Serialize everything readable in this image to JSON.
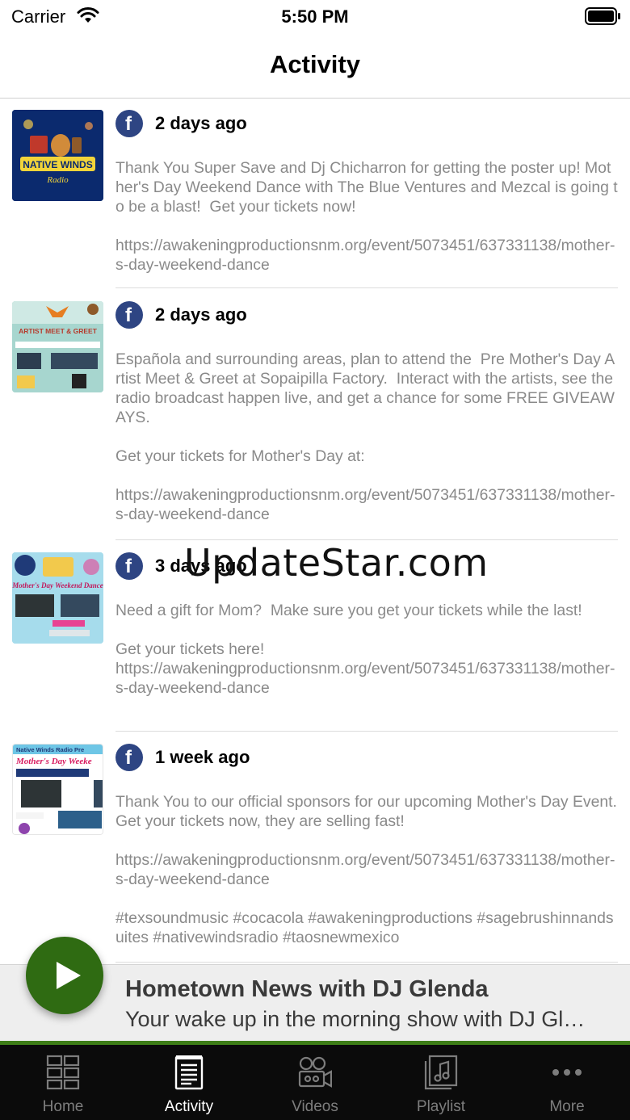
{
  "status_bar": {
    "carrier": "Carrier",
    "time": "5:50 PM"
  },
  "nav": {
    "title": "Activity"
  },
  "posts": [
    {
      "source_icon": "facebook-icon",
      "time": "2 days ago",
      "text": "Thank You Super Save and Dj Chicharron for getting the poster up! Mother's Day Weekend Dance with The Blue Ventures and Mezcal is going to be a blast!  Get your tickets now!\n\nhttps://awakeningproductionsnm.org/event/5073451/637331138/mother-s-day-weekend-dance",
      "thumb_logo_text": "NATIVE WINDS"
    },
    {
      "source_icon": "facebook-icon",
      "time": "2 days ago",
      "text": "Española and surrounding areas, plan to attend the  Pre Mother's Day Artist Meet & Greet at Sopaipilla Factory.  Interact with the artists, see the radio broadcast happen live, and get a chance for some FREE GIVEAWAYS.\n\nGet your tickets for Mother's Day at:\n\nhttps://awakeningproductionsnm.org/event/5073451/637331138/mother-s-day-weekend-dance",
      "thumb_logo_text": "ARTIST MEET & GREET"
    },
    {
      "source_icon": "facebook-icon",
      "time": "3 days ago",
      "text": "Need a gift for Mom?  Make sure you get your tickets while the last!\n\nGet your tickets here!\nhttps://awakeningproductionsnm.org/event/5073451/637331138/mother-s-day-weekend-dance",
      "thumb_logo_text": "Mother's Day Weekend Dance"
    },
    {
      "source_icon": "facebook-icon",
      "time": "1 week ago",
      "text": "Thank You to our official sponsors for our upcoming Mother's Day Event.  Get your tickets now, they are selling fast!\n\nhttps://awakeningproductionsnm.org/event/5073451/637331138/mother-s-day-weekend-dance\n\n#texsoundmusic #cocacola #awakeningproductions #sagebrushinnandsuites #nativewindsradio #taosnewmexico",
      "thumb_logo_text": "Mother's Day Weeke"
    }
  ],
  "watermark": "UpdateStar.com",
  "player": {
    "title": "Hometown News with DJ Glenda",
    "subtitle": "Your wake up in the morning show with DJ Glenda"
  },
  "tabs": [
    {
      "label": "Home",
      "icon": "grid-icon",
      "active": false
    },
    {
      "label": "Activity",
      "icon": "document-icon",
      "active": true
    },
    {
      "label": "Videos",
      "icon": "video-icon",
      "active": false
    },
    {
      "label": "Playlist",
      "icon": "music-note-icon",
      "active": false
    },
    {
      "label": "More",
      "icon": "more-dots-icon",
      "active": false
    }
  ],
  "colors": {
    "accent": "#2f6b12",
    "facebook": "#2e4583",
    "tab_bar": "#0b0b0b"
  }
}
